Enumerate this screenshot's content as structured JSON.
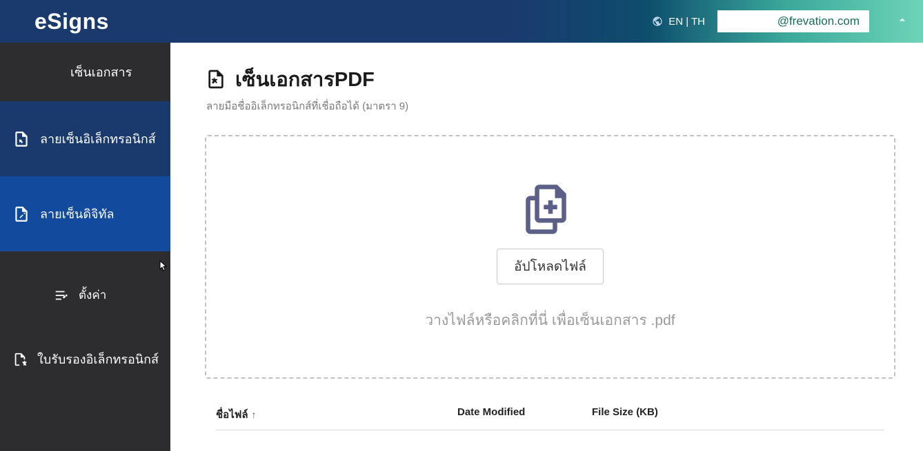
{
  "header": {
    "logo": "eSigns",
    "lang": "EN | TH",
    "user_email": "@frevation.com"
  },
  "sidebar": {
    "items": [
      {
        "label": "เซ็นเอกสาร"
      },
      {
        "label": "ลายเซ็นอิเล็กทรอนิกส์"
      },
      {
        "label": "ลายเซ็นดิจิทัล"
      },
      {
        "label": "ตั้งค่า"
      },
      {
        "label": "ใบรับรองอิเล็กทรอนิกส์"
      }
    ]
  },
  "main": {
    "title": "เซ็นเอกสารPDF",
    "subtitle": "ลายมือชื่ออิเล็กทรอนิกส์ที่เชื่อถือได้ (มาตรา 9)",
    "upload_label": "อัปโหลดไฟล์",
    "drop_hint": "วางไฟล์หรือคลิกที่นี่ เพื่อเซ็นเอกสาร .pdf"
  },
  "table": {
    "col_name": "ชื่อไฟล์",
    "sort_dir": "↑",
    "col_date": "Date Modified",
    "col_size": "File Size (KB)",
    "rows": []
  }
}
